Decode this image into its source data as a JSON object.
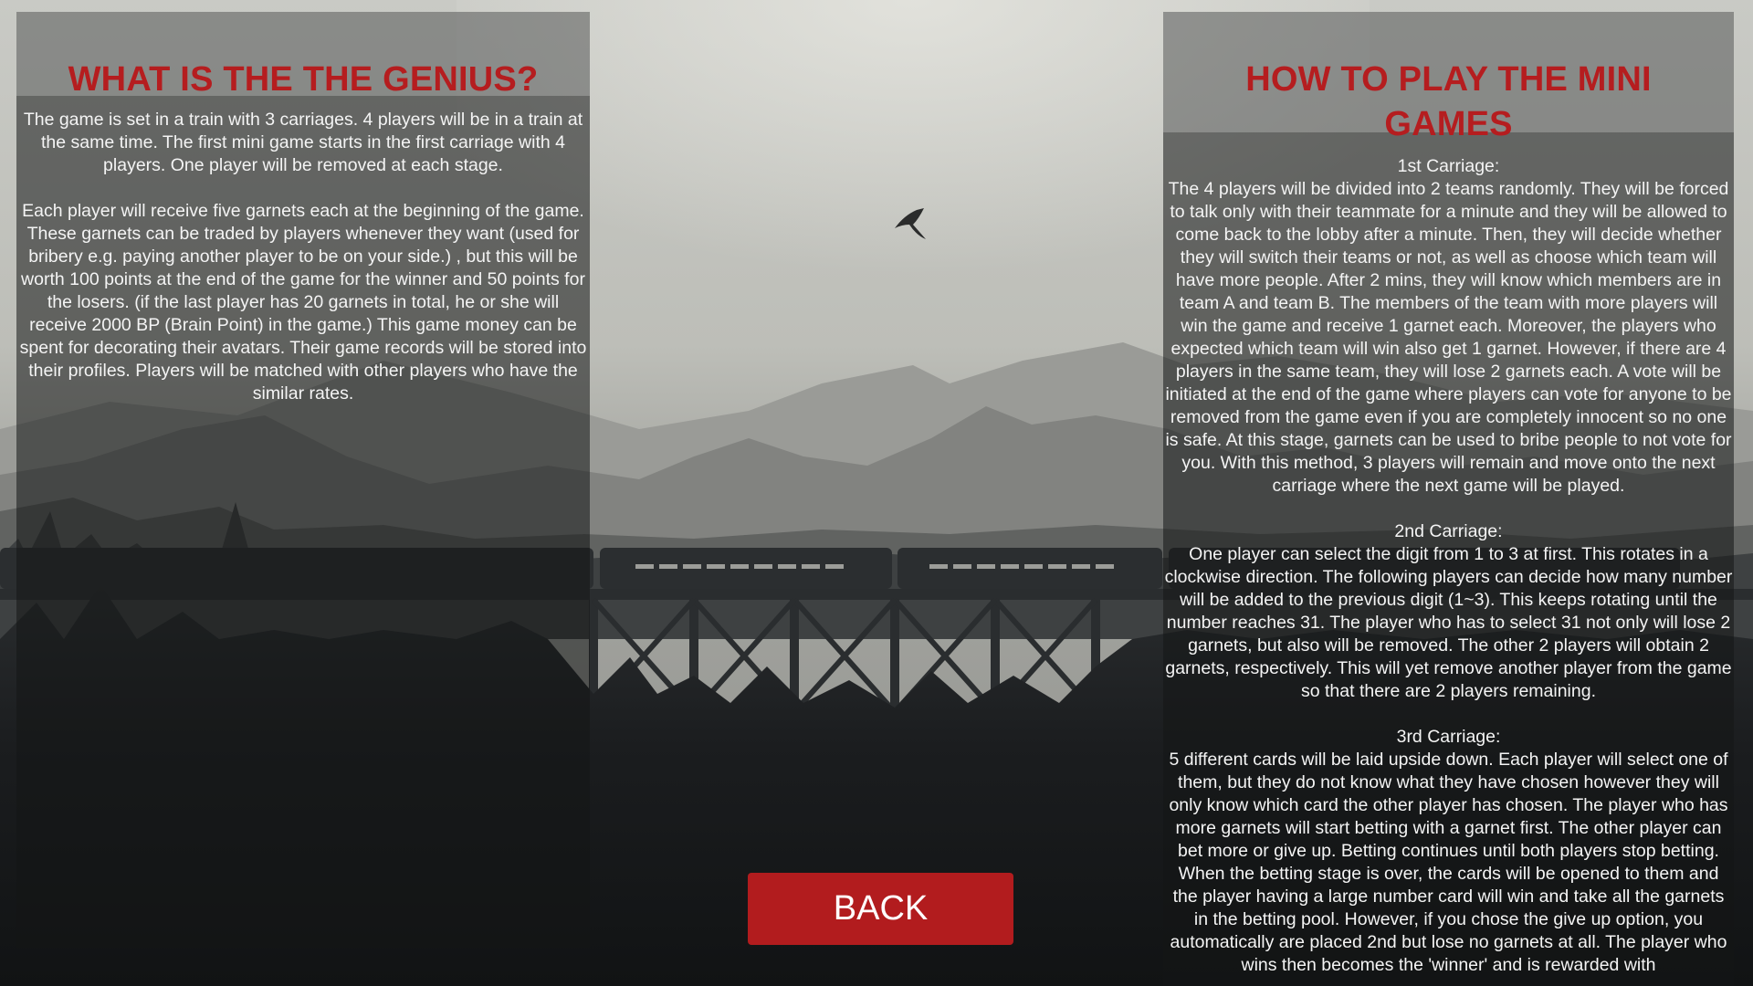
{
  "left_panel": {
    "title": "WHAT IS THE THE GENIUS?",
    "body": "The game is set in a train with 3 carriages. 4 players will be in a train at the same time. The first mini game starts in the first carriage with 4 players. One player will be removed at each stage.\n\nEach player will receive five garnets each at the beginning of the game. These garnets can be traded by players whenever they want (used for bribery e.g. paying another player to be on your side.) , but this will be worth 100 points at the end of the game for the winner and 50 points for the losers. (if the last player has 20 garnets in total, he or she will receive 2000 BP (Brain Point) in the game.) This game money can be spent for decorating their avatars. Their game records will be stored into their profiles. Players will be matched with other players who have the similar rates."
  },
  "right_panel": {
    "title": "HOW TO PLAY THE MINI GAMES",
    "body": "1st Carriage:\nThe 4 players will be divided into 2 teams randomly. They will be forced to talk only with their teammate for a minute and they will be allowed to come back to the lobby after a minute. Then, they will decide whether they will switch their teams or not, as well as choose which team will have more people. After 2 mins, they will know which members are in team A and team B. The members of the team with more players will win the game and receive 1 garnet each. Moreover, the players who expected which team will win also get 1 garnet. However, if there are 4 players in the same team, they will lose 2 garnets each. A vote will be initiated at the end of the game where players can vote for anyone to be removed from the game even if you are completely innocent so no one is safe. At this stage, garnets can be used to bribe people to not vote for you. With this method, 3 players will remain and move onto the next carriage where the next game will be played.\n\n2nd Carriage:\nOne player can select the digit from 1 to 3 at first. This rotates in a clockwise direction. The following players can decide how many number will be added to the previous digit (1~3). This keeps rotating until the number reaches 31. The player who has to select 31 not only will lose 2 garnets, but also will be removed. The other 2 players will obtain 2 garnets, respectively. This will yet remove another player from the game so that there are 2 players remaining.\n\n3rd Carriage:\n5 different cards will be laid upside down. Each player will select one of them, but they do not know what they have chosen however they will only know which card the other player has chosen. The player who has more garnets will start betting with a garnet first. The other player can bet more or give up. Betting continues until both players stop betting. When the betting stage is over, the cards will be opened to them and the player having a large number card will win and take all the garnets in the betting pool. However, if you chose the give up option, you automatically are placed 2nd but lose no garnets at all. The player who wins then becomes the 'winner' and is rewarded with"
  },
  "back_button": {
    "label": "BACK"
  }
}
